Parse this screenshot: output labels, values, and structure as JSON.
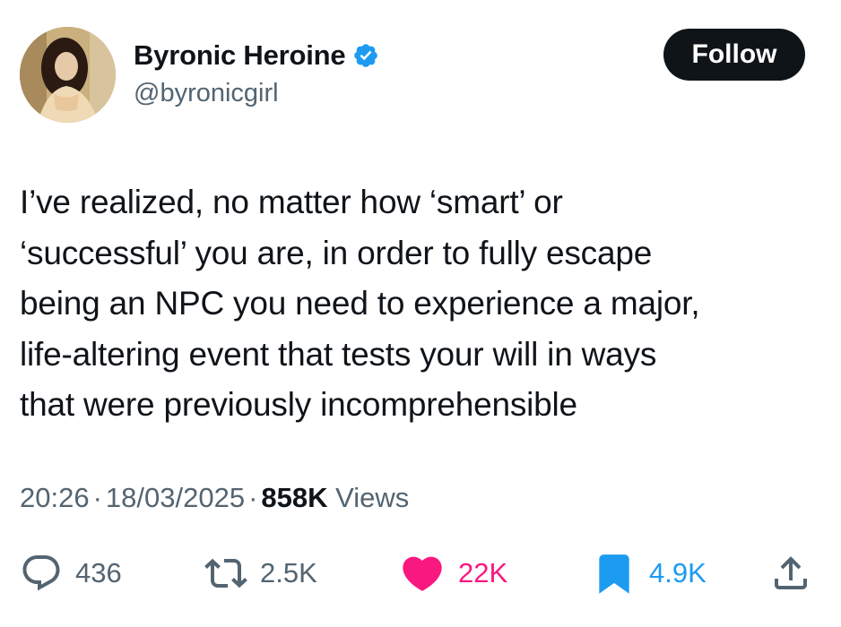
{
  "user": {
    "display_name": "Byronic Heroine",
    "handle": "@byronicgirl",
    "verified": true,
    "verified_color": "#1d9bf0"
  },
  "follow_label": "Follow",
  "tweet": {
    "lines": [
      "I’ve realized, no matter how ‘smart’ or",
      "‘successful’ you are, in order to fully escape",
      "being an NPC you need to experience a major,",
      "life-altering event that tests your will in ways",
      "that were previously incomprehensible"
    ]
  },
  "meta": {
    "time": "20:26",
    "date": "18/03/2025",
    "views_count": "858K",
    "views_label": "Views"
  },
  "actions": {
    "replies": "436",
    "retweets": "2.5K",
    "likes": "22K",
    "bookmarks": "4.9K"
  },
  "colors": {
    "text": "#0f1419",
    "secondary": "#536471",
    "like": "#f91880",
    "bookmark": "#1d9bf0"
  },
  "icons": {
    "reply": "speech-bubble-icon",
    "retweet": "retweet-arrows-icon",
    "like": "heart-icon",
    "bookmark": "bookmark-icon",
    "share": "share-upload-icon"
  }
}
